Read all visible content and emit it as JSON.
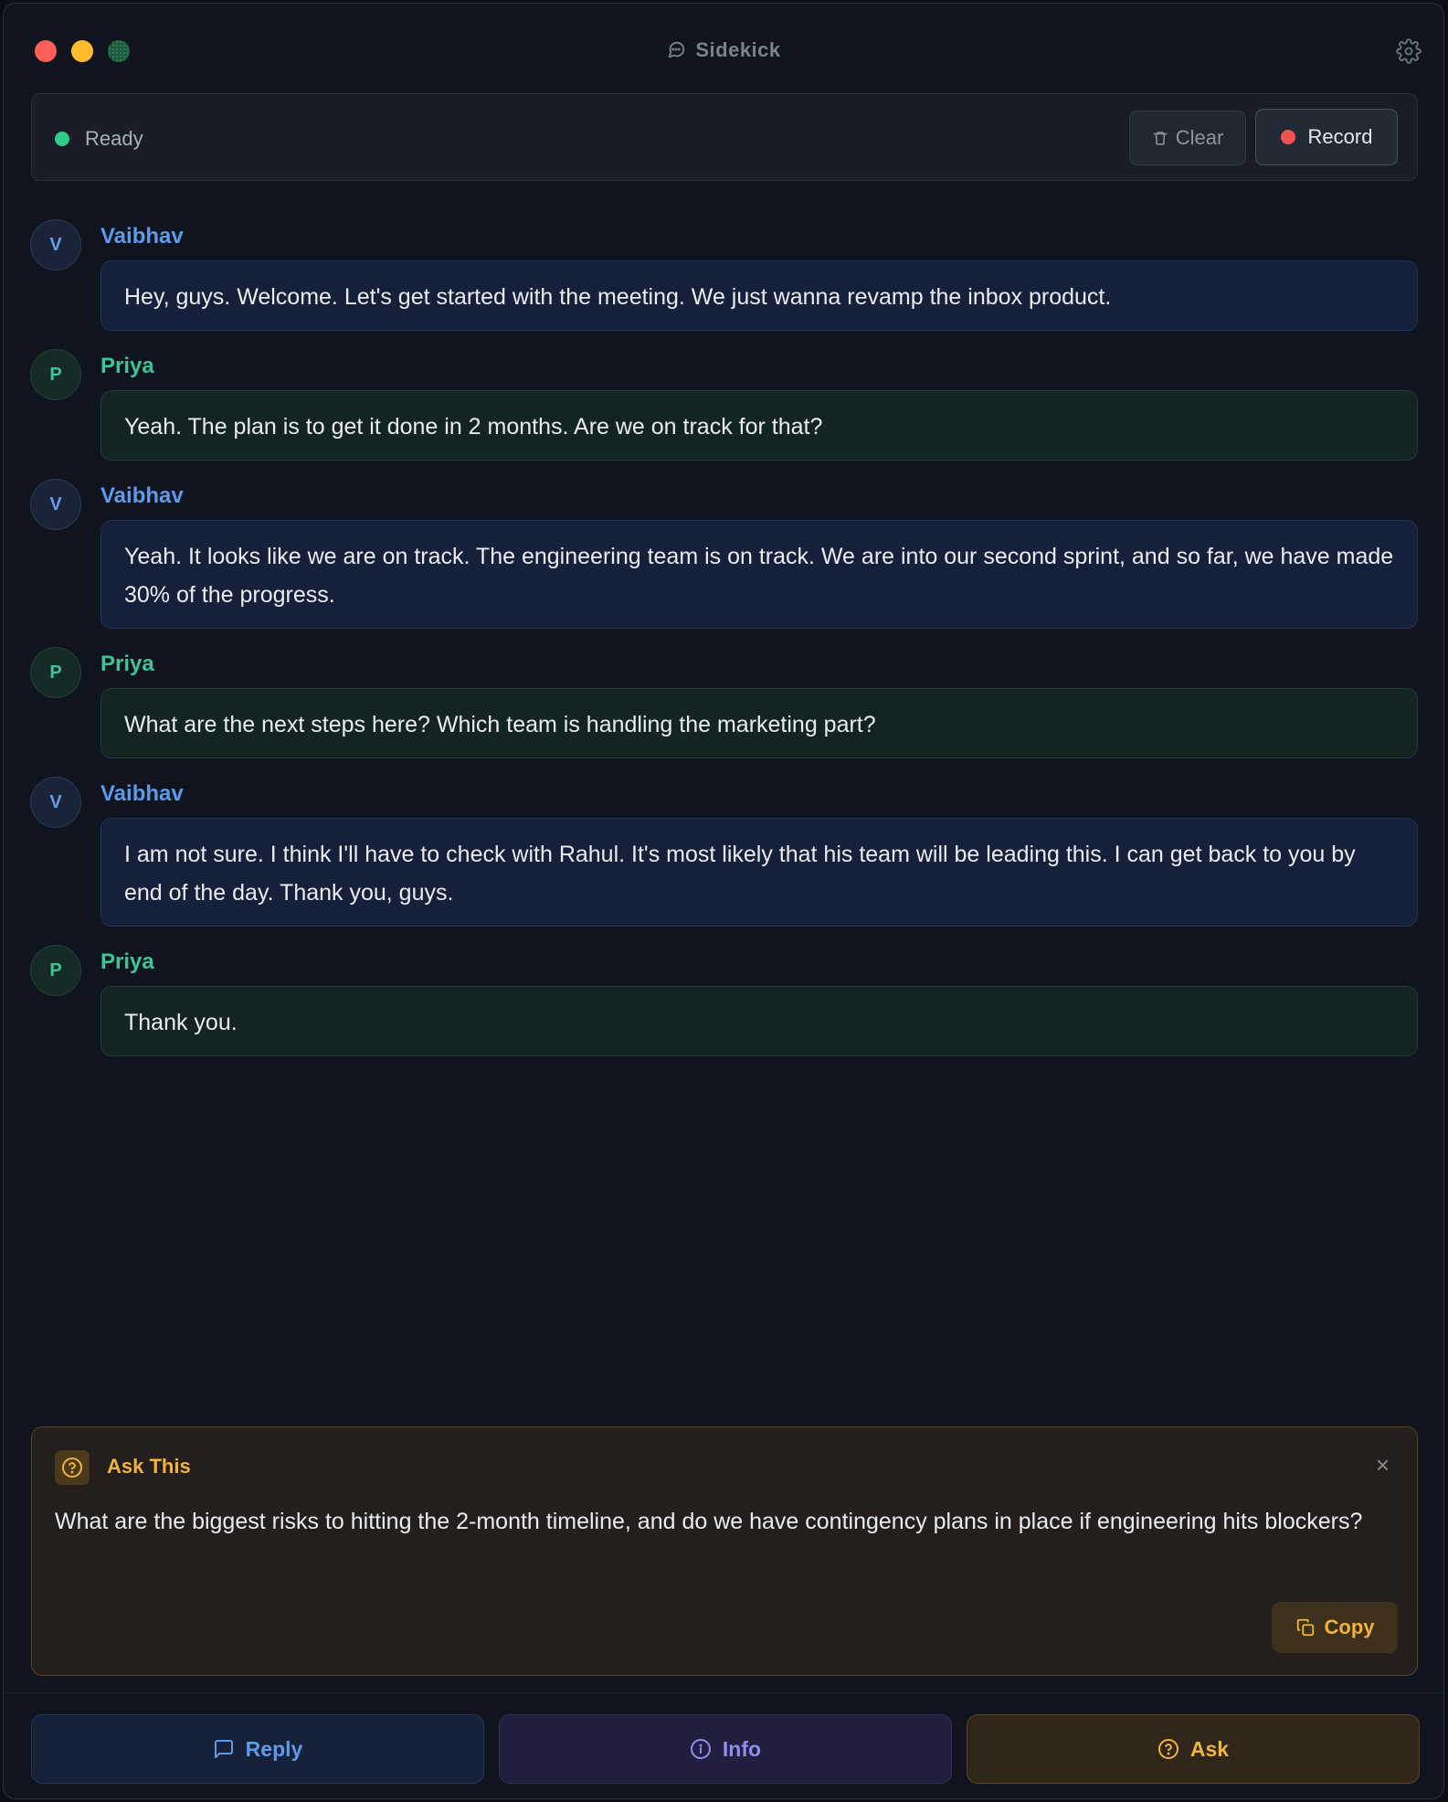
{
  "window": {
    "title": "Sidekick"
  },
  "status": {
    "text": "Ready",
    "clear_label": "Clear",
    "record_label": "Record"
  },
  "messages": [
    {
      "initial": "V",
      "speaker": "Vaibhav",
      "text": "Hey, guys. Welcome. Let's get started with the meeting. We just wanna revamp the inbox product."
    },
    {
      "initial": "P",
      "speaker": "Priya",
      "text": "Yeah. The plan is to get it done in 2 months. Are we on track for that?"
    },
    {
      "initial": "V",
      "speaker": "Vaibhav",
      "text": "Yeah. It looks like we are on track. The engineering team is on track. We are into our second sprint, and so far, we have made 30% of the progress."
    },
    {
      "initial": "P",
      "speaker": "Priya",
      "text": "What are the next steps here? Which team is handling the marketing part?"
    },
    {
      "initial": "V",
      "speaker": "Vaibhav",
      "text": "I am not sure. I think I'll have to check with Rahul. It's most likely that his team will be leading this. I can get back to you by end of the day. Thank you, guys."
    },
    {
      "initial": "P",
      "speaker": "Priya",
      "text": "Thank you."
    }
  ],
  "ask_card": {
    "title": "Ask This",
    "close_glyph": "×",
    "text": "What are the biggest risks to hitting the 2-month timeline, and do we have contingency plans in place if engineering hits blockers?",
    "copy_label": "Copy"
  },
  "actions": {
    "reply_label": "Reply",
    "info_label": "Info",
    "ask_label": "Ask"
  },
  "colors": {
    "accent_blue": "#5f9ae8",
    "accent_green": "#3ec496",
    "accent_amber": "#f2b33a",
    "status_ready": "#2ecc8a",
    "record_red": "#f05252"
  },
  "icons": {
    "title": "chat-bubble-icon",
    "settings": "gear-icon",
    "clear": "trash-icon",
    "ask_card": "question-circle-icon",
    "copy": "copy-icon",
    "reply": "message-square-icon",
    "info": "info-circle-icon",
    "ask": "question-circle-icon"
  }
}
